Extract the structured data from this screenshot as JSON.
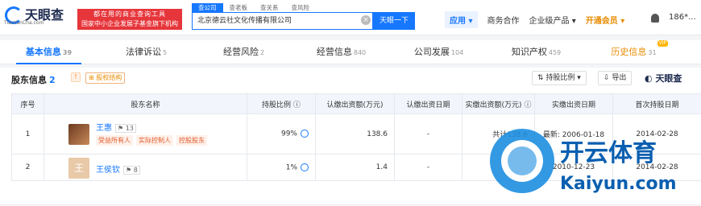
{
  "brand": {
    "name": "天眼查",
    "sub": "TianYanCha.com"
  },
  "promo": {
    "line1": "都在用的商业查询工具",
    "line2": "国家中小企业发展子基金旗下机构"
  },
  "search": {
    "tabs": [
      "查公司",
      "查老板",
      "查关系",
      "查风险"
    ],
    "value": "北京德云社文化传播有限公司",
    "button": "天眼一下"
  },
  "nav": {
    "app": "应用",
    "items": [
      "商务合作",
      "企业级产品"
    ],
    "vip": "开通会员",
    "user": "186*..."
  },
  "tabs": [
    {
      "label": "基本信息",
      "count": "39"
    },
    {
      "label": "法律诉讼",
      "count": "5"
    },
    {
      "label": "经营风险",
      "count": "2"
    },
    {
      "label": "经营信息",
      "count": "840"
    },
    {
      "label": "公司发展",
      "count": "104"
    },
    {
      "label": "知识产权",
      "count": "459"
    },
    {
      "label": "历史信息",
      "count": "31"
    }
  ],
  "vip_tag": "VIP",
  "section": {
    "title": "股东信息",
    "count": "2",
    "link": "股权结构",
    "sort": "持股比例",
    "export": "导出",
    "brand": "天眼查"
  },
  "table": {
    "headers": [
      "序号",
      "股东名称",
      "持股比例",
      "认缴出资额(万元)",
      "认缴出资日期",
      "实缴出资额(万元)",
      "实缴出资日期",
      "首次持股日期"
    ],
    "rows": [
      {
        "idx": "1",
        "name": "王惠",
        "count": "13",
        "roles": [
          "受益所有人",
          "实际控制人",
          "控股股东"
        ],
        "ratio": "99%",
        "amount": "138.6",
        "date": "-",
        "paid": "共计138.6",
        "paid_date": "最新: 2006-01-18",
        "first": "2014-02-28"
      },
      {
        "idx": "2",
        "name": "王侯钦",
        "avatar_char": "王",
        "count": "8",
        "roles": [],
        "ratio": "1%",
        "amount": "1.4",
        "date": "-",
        "paid": "",
        "paid_date": "2010-12-23",
        "first": "2014-02-28"
      }
    ]
  },
  "watermark": {
    "cn": "开云体育",
    "en": "Kaiyun.com"
  }
}
